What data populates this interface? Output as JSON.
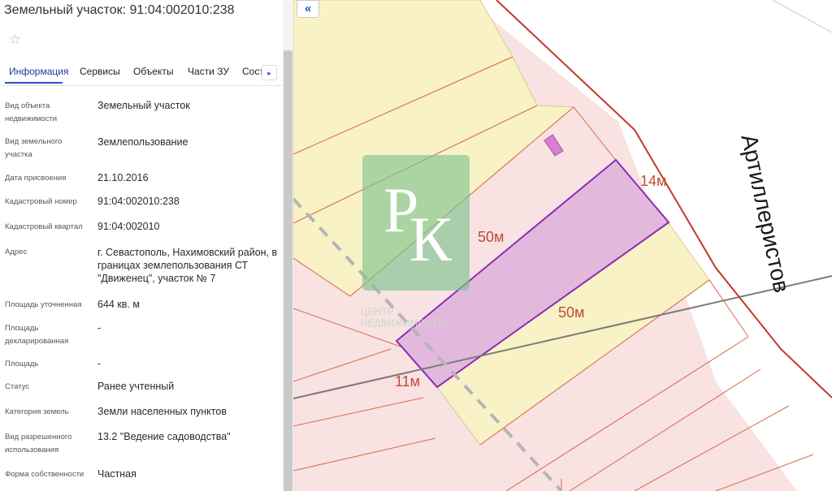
{
  "panel": {
    "title": "Земельный участок: 91:04:002010:238",
    "star_glyph": "☆",
    "tabs": [
      {
        "label": "Информация"
      },
      {
        "label": "Сервисы"
      },
      {
        "label": "Объекты"
      },
      {
        "label": "Части ЗУ"
      },
      {
        "label": "Сост"
      }
    ],
    "tab_next_glyph": "▸",
    "properties": [
      {
        "label": "Вид объекта недвижимости",
        "value": "Земельный участок"
      },
      {
        "label": "Вид земельного участка",
        "value": "Землепользование"
      },
      {
        "label": "Дата присвоения",
        "value": "21.10.2016"
      },
      {
        "label": "Кадастровый номер",
        "value": "91:04:002010:238"
      },
      {
        "label": "Кадастровый квартал",
        "value": "91:04:002010"
      },
      {
        "label": "Адрес",
        "value": "г. Севастополь, Нахимовский район, в границах землепользования СТ \"Движенец\", участок № 7"
      },
      {
        "label": "Площадь уточненная",
        "value": "644 кв. м"
      },
      {
        "label": "Площадь декларированная",
        "value": "-"
      },
      {
        "label": "Площадь",
        "value": "-"
      },
      {
        "label": "Статус",
        "value": "Ранее учтенный"
      },
      {
        "label": "Категория земель",
        "value": "Земли населенных пунктов"
      },
      {
        "label": "Вид разрешенного использования",
        "value": "13.2 \"Ведение садоводства\""
      },
      {
        "label": "Форма собственности",
        "value": "Частная"
      }
    ]
  },
  "map": {
    "collapse_glyph": "«",
    "street_name": "Артиллеристов",
    "dimensions": {
      "top_right": "14м",
      "left_side": "50м",
      "right_side": "50м",
      "bottom": "11м"
    },
    "watermark": {
      "letter1": "Р",
      "letter2": "К",
      "line1": "ЦЕНТР",
      "line2": "НЕДВИЖИМОСТИ"
    },
    "colors": {
      "parcel_fill": "#e2b9dc",
      "parcel_border": "#8e2bb5",
      "neighbor_fill": "#f8f2c6",
      "base_fill": "#f8e2e2",
      "boundary_red": "#c0392b",
      "road": "#ffffff"
    }
  }
}
